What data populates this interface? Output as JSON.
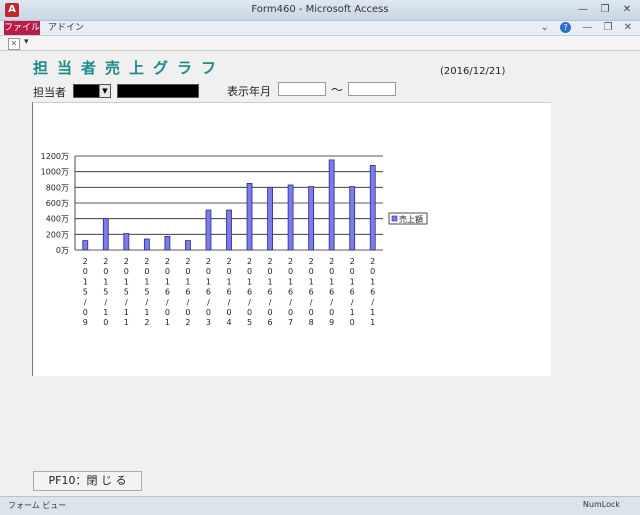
{
  "window": {
    "title": "Form460  -  Microsoft Access",
    "app_icon": "A",
    "minimize": "—",
    "restore": "❐",
    "close": "✕"
  },
  "ribbon": {
    "tab_file": "ファイル",
    "tab_addin": "アドイン",
    "help": "?",
    "min_ribbon": "—",
    "restore_ribbon": "❐",
    "close_ribbon": "✕"
  },
  "docbar": {
    "close": "✕",
    "arrow": "▾"
  },
  "form": {
    "title": "担当者売上グラフ",
    "date": "(2016/12/21)",
    "staff_label": "担当者",
    "combo_arrow": "▼",
    "ym_label": "表示年月",
    "ym_from": "",
    "ym_to": "",
    "tilde": "～",
    "close_button": "PF10：閉 じ る"
  },
  "colors": {
    "bar_fill": "#7b7bea",
    "bar_stroke": "#2a2a8a",
    "title": "#1b8a8a"
  },
  "chart_data": {
    "type": "bar",
    "categories": [
      "2015/09",
      "2015/10",
      "2015/11",
      "2015/12",
      "2016/01",
      "2016/02",
      "2016/03",
      "2016/04",
      "2016/05",
      "2016/06",
      "2016/07",
      "2016/08",
      "2016/09",
      "2016/10",
      "2016/11"
    ],
    "series": [
      {
        "name": "売上額",
        "values": [
          120,
          400,
          210,
          140,
          175,
          120,
          510,
          510,
          850,
          800,
          830,
          810,
          1150,
          810,
          1080
        ]
      }
    ],
    "ylim": [
      0,
      1200
    ],
    "yticks": [
      0,
      200,
      400,
      600,
      800,
      1000,
      1200
    ],
    "ytick_labels": [
      "0万",
      "200万",
      "400万",
      "600万",
      "800万",
      "1000万",
      "1200万"
    ],
    "grid": true,
    "legend": "right"
  },
  "status": {
    "left": "フォーム ビュー",
    "right": "NumLock"
  }
}
